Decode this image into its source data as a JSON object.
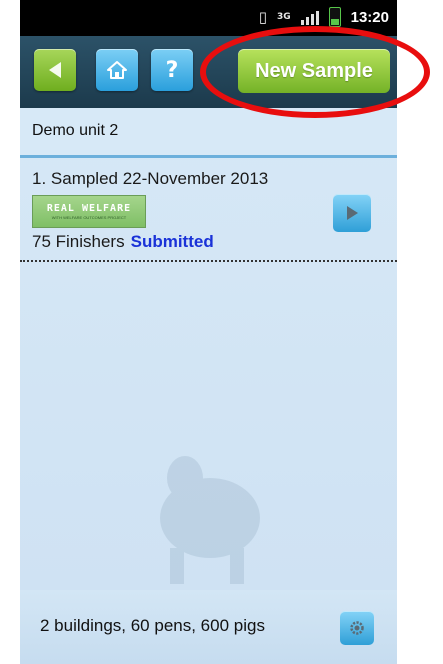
{
  "statusbar": {
    "network_label": "3G",
    "time": "13:20"
  },
  "toolbar": {
    "back_icon": "back-arrow-icon",
    "home_icon": "home-icon",
    "help_label": "?",
    "new_sample_label": "New Sample"
  },
  "unit": {
    "title": "Demo unit 2"
  },
  "samples": [
    {
      "title": "1. Sampled 22-November 2013",
      "logo_text": "REAL WELFARE",
      "logo_subtext": "WITH WELFARE OUTCOMES PROJECT",
      "count_label": "75 Finishers",
      "status": "Submitted"
    }
  ],
  "footer": {
    "summary": "2 buildings, 60 pens, 600 pigs"
  },
  "colors": {
    "accent_green": "#7ab830",
    "accent_blue": "#2a9fdc",
    "status_blue": "#1a32d8",
    "callout_red": "#e80e0e"
  }
}
